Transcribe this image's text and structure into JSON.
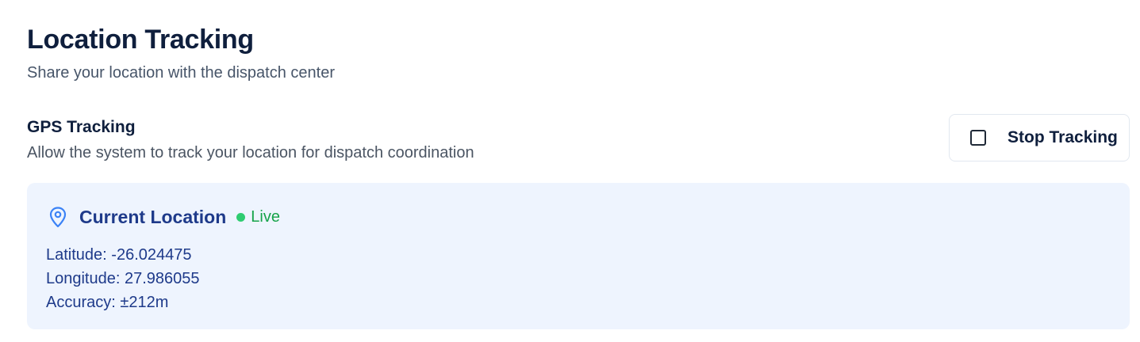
{
  "header": {
    "title": "Location Tracking",
    "subtitle": "Share your location with the dispatch center"
  },
  "gps": {
    "title": "GPS Tracking",
    "description": "Allow the system to track your location for dispatch coordination",
    "button_label": "Stop Tracking",
    "button_icon": "checkbox-icon"
  },
  "location": {
    "title": "Current Location",
    "icon": "map-pin-icon",
    "status": "Live",
    "status_color": "#2ecc71",
    "latitude_line": "Latitude: -26.024475",
    "longitude_line": "Longitude: 27.986055",
    "accuracy_line": "Accuracy: ±212m"
  },
  "colors": {
    "title": "#0f1f3d",
    "card_background": "#eef4fe",
    "card_text": "#1e3a8a",
    "live_text": "#16a34a",
    "pin_icon": "#3b82f6"
  }
}
